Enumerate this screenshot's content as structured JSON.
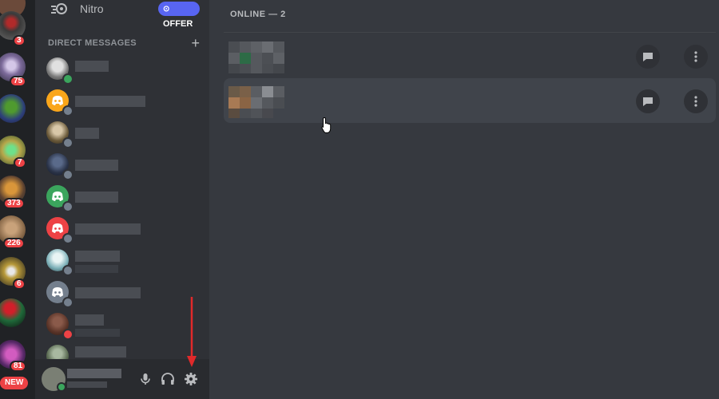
{
  "nitro": {
    "label": "Nitro",
    "offer": "OFFER"
  },
  "dm_header": {
    "label": "DIRECT MESSAGES",
    "add": "+"
  },
  "guild_badges": [
    "3",
    "75",
    "7",
    "373",
    "226",
    "6",
    "81"
  ],
  "new_badge": "NEW",
  "friends": {
    "online_label": "ONLINE — 2"
  },
  "icons": {
    "nitro": "nitro-icon",
    "add": "plus-icon",
    "mic": "microphone-icon",
    "headset": "headphones-icon",
    "settings": "gear-icon",
    "message": "chat-bubble-icon",
    "more": "vertical-dots-icon"
  },
  "colors": {
    "blurple": "#5865f2",
    "badge": "#ed4245",
    "online": "#3ba55d",
    "idle_offline": "#747f8d",
    "dnd": "#ed4245",
    "sidebar": "#2f3136",
    "guild_bar": "#202225",
    "main_bg": "#36393f",
    "arrow": "#e0292a"
  }
}
